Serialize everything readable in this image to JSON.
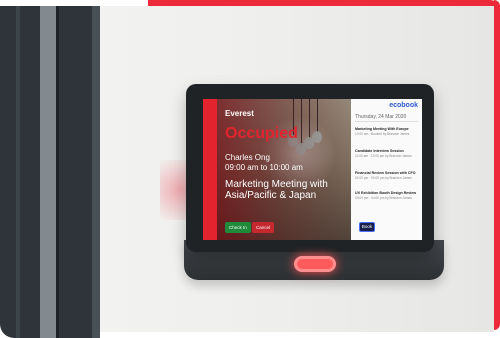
{
  "room": {
    "name": "Everest",
    "status": "Occupied",
    "booker": "Charles Ong",
    "time": "09:00 am to 10:00 am",
    "meeting_title": "Marketing Meeting with Asia/Pacific & Japan"
  },
  "actions": {
    "check_in": "Check In",
    "cancel": "Cancel",
    "book": "Book"
  },
  "brand": {
    "logo_text": "ecobook"
  },
  "schedule": {
    "date": "Thursday, 24 Mar 2020",
    "items": [
      {
        "title": "Marketing Meeting With Europe",
        "meta": "10:00 am · Booked by Brandon James"
      },
      {
        "title": "Candidate Interview Session",
        "meta": "11:00 am · 12:00 pm by Brandon James"
      },
      {
        "title": "Financial Review Session with CFO",
        "meta": "01:00 pm · 02:00 pm by Brandon James"
      },
      {
        "title": "UX Exhibition Booth Design Review",
        "meta": "03:00 pm · 04:00 pm by Brandon James"
      }
    ]
  },
  "colors": {
    "accent_red": "#e3242f",
    "brand_blue": "#2d5bd1",
    "check_in_green": "#1f8b3a",
    "led_red": "#ff5b5b"
  }
}
